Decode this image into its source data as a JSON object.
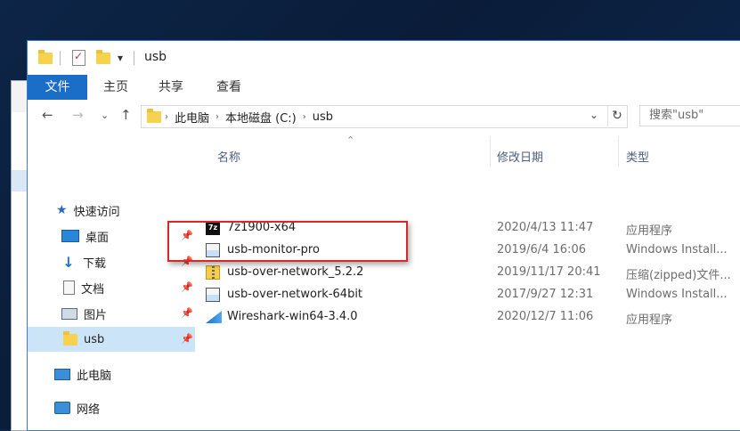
{
  "window": {
    "title": "usb"
  },
  "ribbon": {
    "tabs": [
      "文件",
      "主页",
      "共享",
      "查看"
    ]
  },
  "address": {
    "crumbs": [
      "此电脑",
      "本地磁盘 (C:)",
      "usb"
    ],
    "search_placeholder": "搜索\"usb\""
  },
  "nav": {
    "items": [
      {
        "label": "快速访问",
        "icon": "star-icon",
        "pinned": false
      },
      {
        "label": "桌面",
        "icon": "desktop-icon",
        "pinned": true
      },
      {
        "label": "下载",
        "icon": "download-icon",
        "pinned": true
      },
      {
        "label": "文档",
        "icon": "documents-icon",
        "pinned": true
      },
      {
        "label": "图片",
        "icon": "pictures-icon",
        "pinned": true
      },
      {
        "label": "usb",
        "icon": "folder-icon",
        "pinned": true,
        "selected": true
      },
      {
        "label": "此电脑",
        "icon": "pc-icon",
        "pinned": false
      },
      {
        "label": "网络",
        "icon": "network-icon",
        "pinned": false
      }
    ]
  },
  "columns": {
    "name": "名称",
    "date": "修改日期",
    "type": "类型"
  },
  "files": [
    {
      "name": "7z1900-x64",
      "date": "2020/4/13 11:47",
      "type": "应用程序",
      "icon": "7z-icon"
    },
    {
      "name": "usb-monitor-pro",
      "date": "2019/6/4 16:06",
      "type": "Windows Install...",
      "icon": "msi-icon"
    },
    {
      "name": "usb-over-network_5.2.2",
      "date": "2019/11/17 20:41",
      "type": "压缩(zipped)文件...",
      "icon": "zip-icon"
    },
    {
      "name": "usb-over-network-64bit",
      "date": "2017/9/27 12:31",
      "type": "Windows Install...",
      "icon": "msi-icon"
    },
    {
      "name": "Wireshark-win64-3.4.0",
      "date": "2020/12/7 11:06",
      "type": "应用程序",
      "icon": "wireshark-icon"
    }
  ],
  "colors": {
    "accent": "#1a6ec7",
    "selection": "#cce4f7",
    "highlight_box": "#d62a2a"
  }
}
